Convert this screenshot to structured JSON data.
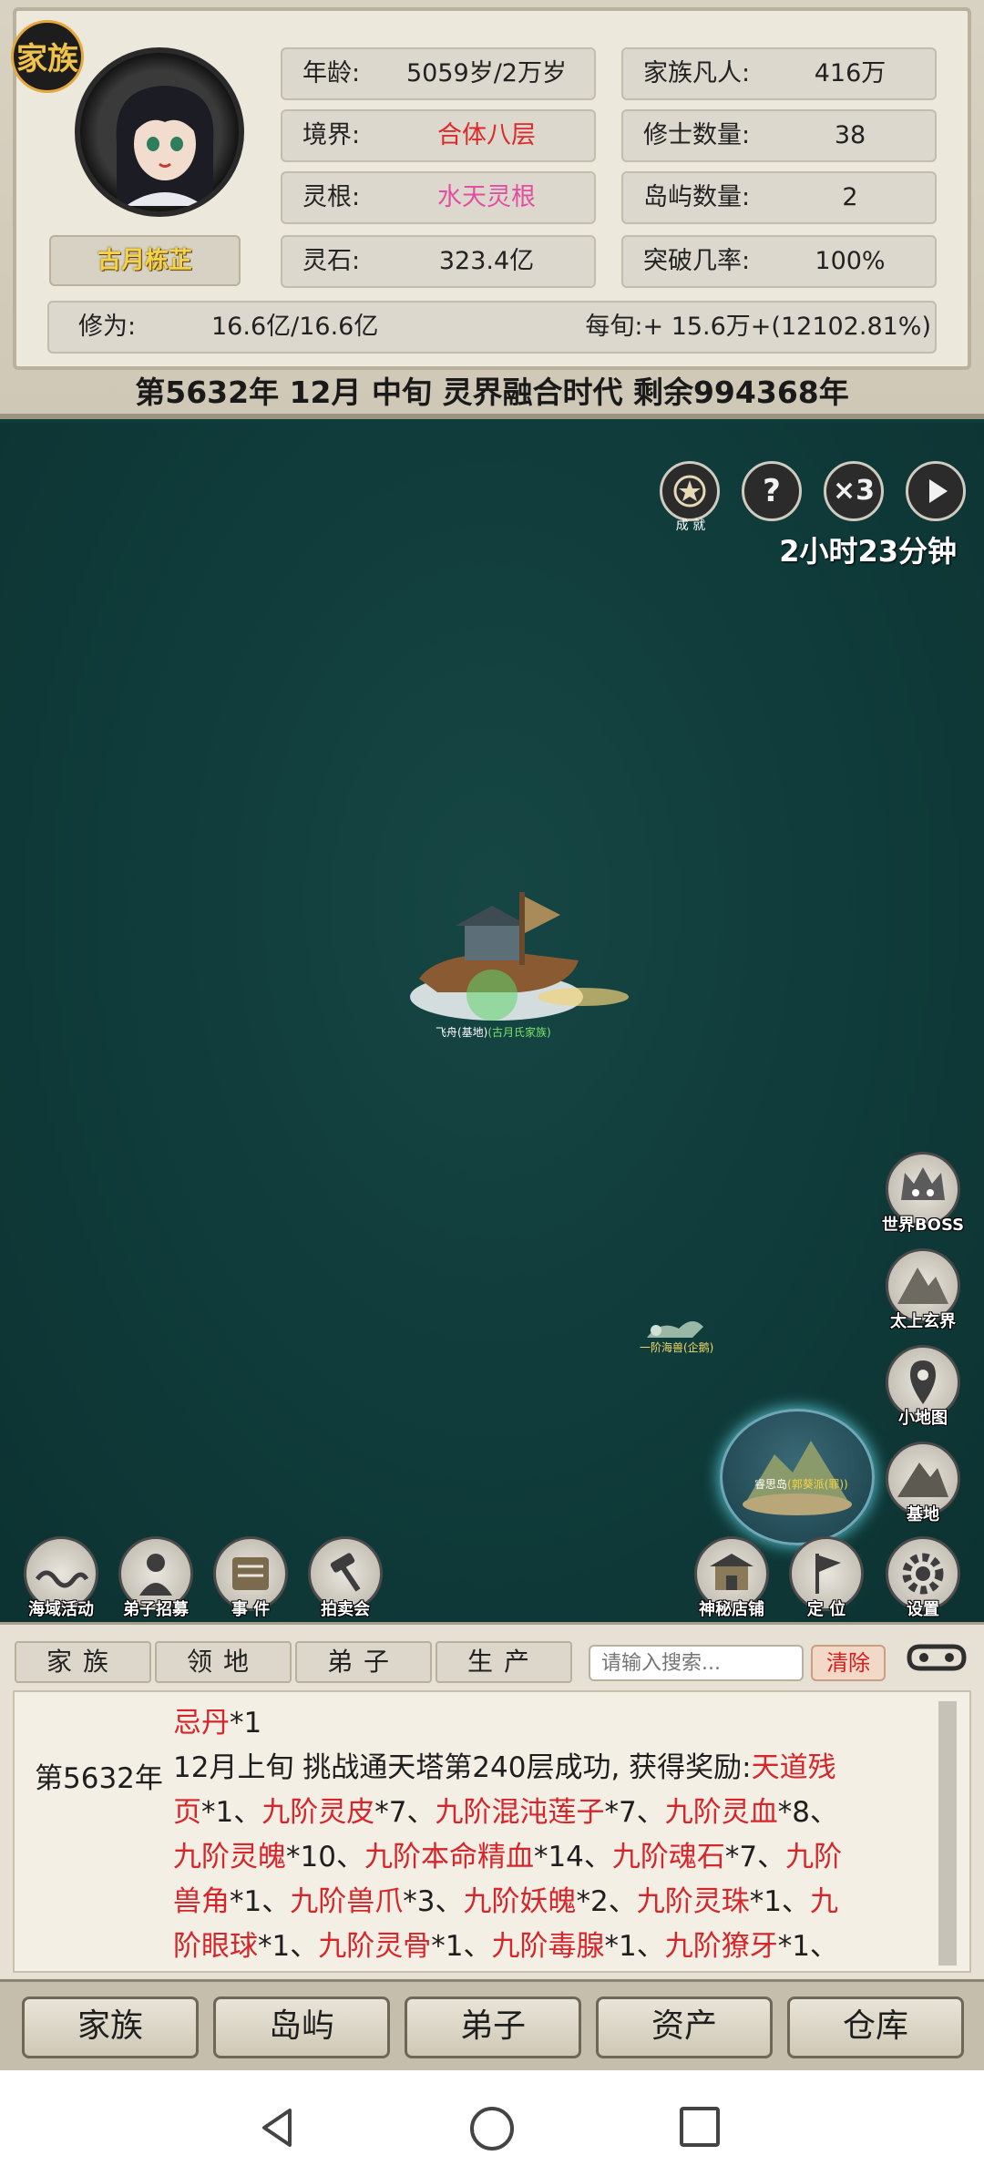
{
  "header": {
    "clan_badge": "家族",
    "character_name": "古月栋芷",
    "stats": {
      "age_label": "年龄:",
      "age_value": "5059岁/2万岁",
      "realm_label": "境界:",
      "realm_value": "合体八层",
      "root_label": "灵根:",
      "root_value": "水天灵根",
      "stone_label": "灵石:",
      "stone_value": "323.4亿",
      "mortals_label": "家族凡人:",
      "mortals_value": "416万",
      "cultivators_label": "修士数量:",
      "cultivators_value": "38",
      "islands_label": "岛屿数量:",
      "islands_value": "2",
      "breakthrough_label": "突破几率:",
      "breakthrough_value": "100%"
    },
    "cultivation_label": "修为:",
    "cultivation_value": "16.6亿/16.6亿",
    "cultivation_rate": "每旬:+ 15.6万+(12102.81%)",
    "date_text": "第5632年 12月 中旬  灵界融合时代 剩余994368年"
  },
  "map": {
    "achievement_label": "成 就",
    "help_label": "?",
    "speed_label": "×3",
    "timer": "2小时23分钟",
    "ship_label_prefix": "飞舟(基地)",
    "ship_label_owner": "(古月氏家族)",
    "beast_label": "一阶海兽(企鹅)",
    "island_label_prefix": "睿思岛",
    "island_label_owner": "(郭葵派(罪))",
    "right_buttons": [
      "世界BOSS",
      "太上玄界",
      "小地图",
      "基地",
      "设置"
    ],
    "bottom_buttons": [
      "海域活动",
      "弟子招募",
      "事 件",
      "拍卖会",
      "神秘店铺",
      "定 位"
    ]
  },
  "log": {
    "tabs": [
      "家族",
      "领地",
      "弟子",
      "生产"
    ],
    "search_placeholder": "请输入搜索...",
    "clear_label": "清除",
    "date": "第5632年",
    "lines": {
      "l1_item": "忌丹",
      "l1_rest": "*1",
      "l2_text": "12月上旬 挑战通天塔第240层成功, 获得奖励:",
      "l2_item": "天道残",
      "l3_item_a": "页",
      "l3_a": "*1、",
      "l3_item_b": "九阶灵皮",
      "l3_b": "*7、",
      "l3_item_c": "九阶混沌莲子",
      "l3_c": "*7、",
      "l3_item_d": "九阶灵血",
      "l3_d": "*8、",
      "l4_item_a": "九阶灵魄",
      "l4_a": "*10、",
      "l4_item_b": "九阶本命精血",
      "l4_b": "*14、",
      "l4_item_c": "九阶魂石",
      "l4_c": "*7、",
      "l4_item_d": "九阶",
      "l5_item_a": "兽角",
      "l5_a": "*1、",
      "l5_item_b": "九阶兽爪",
      "l5_b": "*3、",
      "l5_item_c": "九阶妖魄",
      "l5_c": "*2、",
      "l5_item_d": "九阶灵珠",
      "l5_d": "*1、",
      "l5_item_e": "九",
      "l6_item_a": "阶眼球",
      "l6_a": "*1、",
      "l6_item_b": "九阶灵骨",
      "l6_b": "*1、",
      "l6_item_c": "九阶毒腺",
      "l6_c": "*1、",
      "l6_item_d": "九阶獠牙",
      "l6_d": "*1、"
    }
  },
  "bottom_nav": [
    "家族",
    "岛屿",
    "弟子",
    "资产",
    "仓库"
  ]
}
